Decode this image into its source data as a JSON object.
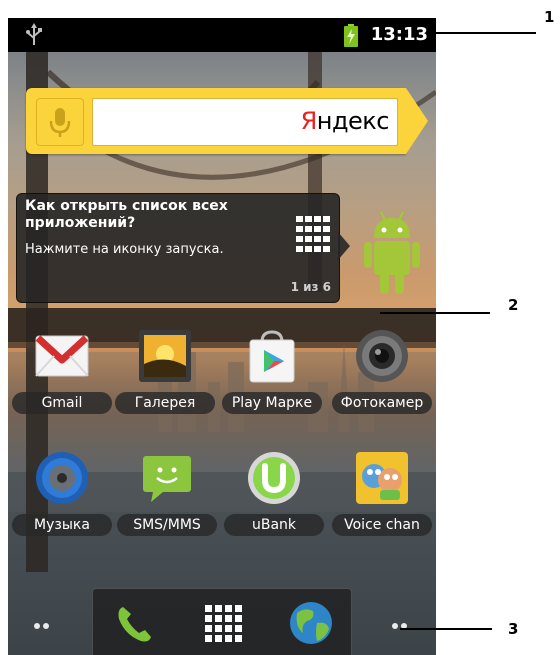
{
  "status_bar": {
    "usb_icon": "usb-icon",
    "battery_icon": "battery-charging-icon",
    "time": "13:13"
  },
  "search_widget": {
    "mic_icon": "microphone-icon",
    "brand_first_letter": "Я",
    "brand_rest": "ндекс",
    "accent_color": "#fbd33a",
    "brand_color": "#e6231e"
  },
  "tooltip": {
    "title": "Как открыть список всех приложений?",
    "body": "Нажмите на иконку запуска.",
    "counter": "1 из 6",
    "icon": "app-grid-icon"
  },
  "apps": [
    {
      "label": "Gmail",
      "icon": "gmail-icon"
    },
    {
      "label": "Галерея",
      "icon": "gallery-icon"
    },
    {
      "label": "Play Марке",
      "icon": "play-market-icon"
    },
    {
      "label": "Фотокамер",
      "icon": "camera-icon"
    },
    {
      "label": "Музыка",
      "icon": "music-icon"
    },
    {
      "label": "SMS/MMS",
      "icon": "sms-icon"
    },
    {
      "label": "uBank",
      "icon": "ubank-icon"
    },
    {
      "label": "Voice chan",
      "icon": "voice-changer-icon"
    }
  ],
  "dock": {
    "phone_icon": "phone-icon",
    "launcher_icon": "app-launcher-icon",
    "browser_icon": "browser-globe-icon"
  },
  "callouts": [
    "1",
    "2",
    "3"
  ]
}
